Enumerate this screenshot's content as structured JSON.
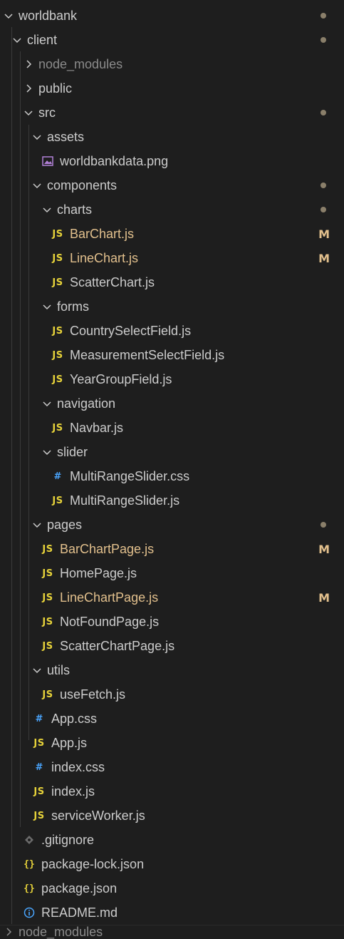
{
  "tree": {
    "root": {
      "label": "worldbank"
    },
    "client": {
      "label": "client"
    },
    "node_modules_client": {
      "label": "node_modules"
    },
    "public": {
      "label": "public"
    },
    "src": {
      "label": "src"
    },
    "assets": {
      "label": "assets"
    },
    "worldbankdata_png": {
      "label": "worldbankdata.png"
    },
    "components": {
      "label": "components"
    },
    "charts": {
      "label": "charts"
    },
    "barchart_js": {
      "label": "BarChart.js",
      "status": "M"
    },
    "linechart_js": {
      "label": "LineChart.js",
      "status": "M"
    },
    "scatterchart_js": {
      "label": "ScatterChart.js"
    },
    "forms": {
      "label": "forms"
    },
    "countryselectfield_js": {
      "label": "CountrySelectField.js"
    },
    "measurementselectfield_js": {
      "label": "MeasurementSelectField.js"
    },
    "yeargroupfield_js": {
      "label": "YearGroupField.js"
    },
    "navigation": {
      "label": "navigation"
    },
    "navbar_js": {
      "label": "Navbar.js"
    },
    "slider": {
      "label": "slider"
    },
    "multirangeslider_css": {
      "label": "MultiRangeSlider.css"
    },
    "multirangeslider_js": {
      "label": "MultiRangeSlider.js"
    },
    "pages": {
      "label": "pages"
    },
    "barchartpage_js": {
      "label": "BarChartPage.js",
      "status": "M"
    },
    "homepage_js": {
      "label": "HomePage.js"
    },
    "linechartpage_js": {
      "label": "LineChartPage.js",
      "status": "M"
    },
    "notfoundpage_js": {
      "label": "NotFoundPage.js"
    },
    "scatterchartpage_js": {
      "label": "ScatterChartPage.js"
    },
    "utils": {
      "label": "utils"
    },
    "usefetch_js": {
      "label": "useFetch.js"
    },
    "app_css": {
      "label": "App.css"
    },
    "app_js": {
      "label": "App.js"
    },
    "index_css": {
      "label": "index.css"
    },
    "index_js": {
      "label": "index.js"
    },
    "serviceworker_js": {
      "label": "serviceWorker.js"
    },
    "gitignore": {
      "label": ".gitignore"
    },
    "package_lock_json": {
      "label": "package-lock.json"
    },
    "package_json": {
      "label": "package.json"
    },
    "readme_md": {
      "label": "README.md"
    },
    "node_modules_root": {
      "label": "node_modules"
    }
  },
  "icons": {
    "js": "JS",
    "css": "#",
    "json": "{}",
    "info": "info-icon",
    "image": "image-icon",
    "git": "gitignore-icon"
  },
  "colors": {
    "background": "#1e1e1e",
    "text": "#cccccc",
    "dim_text": "#8b8b8b",
    "modified": "#e2c08d",
    "js_icon": "#e6d23a",
    "css_icon": "#4aa6ff",
    "dot": "#8a7f6a"
  }
}
